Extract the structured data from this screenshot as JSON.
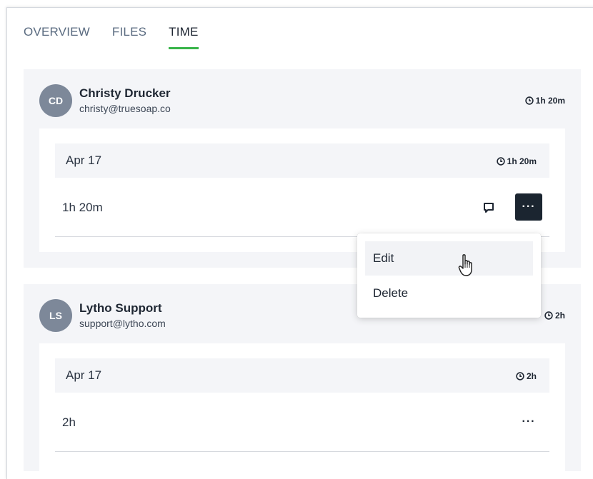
{
  "tabs": [
    {
      "label": "OVERVIEW",
      "active": false
    },
    {
      "label": "FILES",
      "active": false
    },
    {
      "label": "TIME",
      "active": true
    }
  ],
  "users": [
    {
      "initials": "CD",
      "name": "Christy Drucker",
      "email": "christy@truesoap.co",
      "total": "1h 20m",
      "day": {
        "label": "Apr 17",
        "total": "1h 20m"
      },
      "entry": {
        "duration": "1h 20m"
      }
    },
    {
      "initials": "LS",
      "name": "Lytho Support",
      "email": "support@lytho.com",
      "total": "2h",
      "day": {
        "label": "Apr 17",
        "total": "2h"
      },
      "entry": {
        "duration": "2h"
      }
    }
  ],
  "context_menu": {
    "items": [
      {
        "label": "Edit",
        "hovered": true
      },
      {
        "label": "Delete",
        "hovered": false
      }
    ]
  },
  "icons": {
    "clock": "clock-icon",
    "comment": "comment-icon",
    "more": "more-icon",
    "cursor": "hand-pointer-cursor"
  },
  "colors": {
    "active_tab_underline": "#38b449",
    "avatar_bg": "#7d8899",
    "more_button_active": "#1b2530",
    "card_bg": "#f4f5f8"
  }
}
